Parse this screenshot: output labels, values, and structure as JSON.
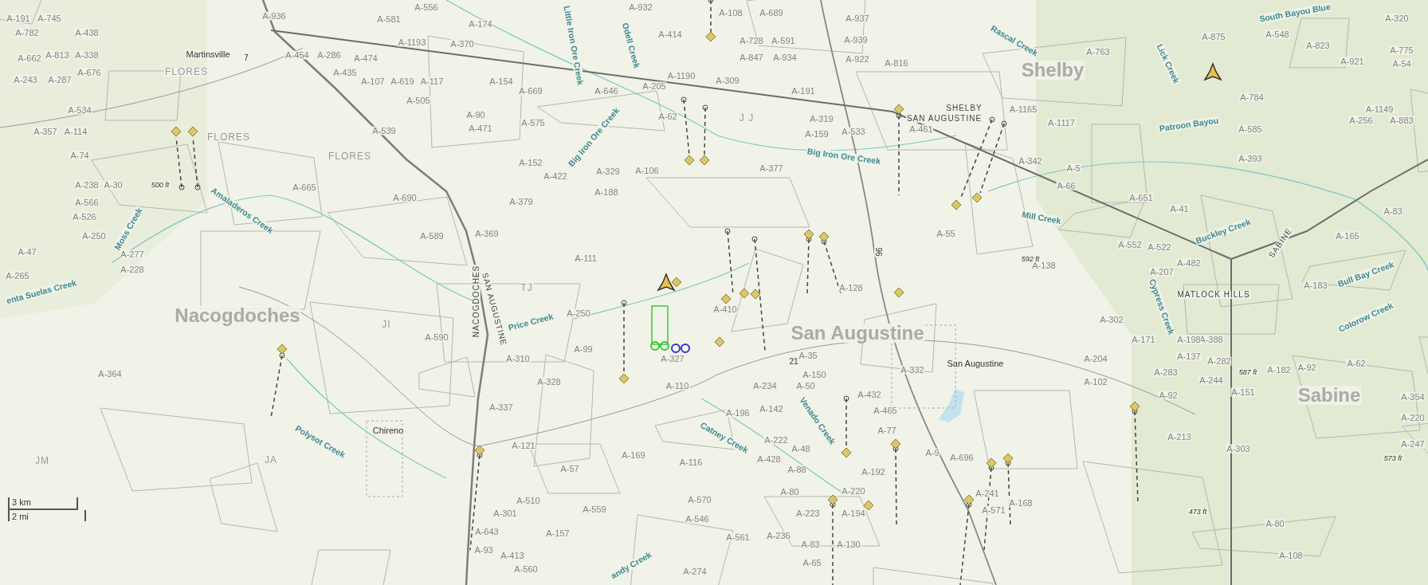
{
  "map": {
    "labels": [
      {
        "text": "Shelby",
        "kind": "county"
      },
      {
        "text": "Nacogdoches",
        "kind": "county"
      },
      {
        "text": "San Augustine",
        "kind": "county"
      },
      {
        "text": "Sabine",
        "kind": "county"
      },
      {
        "text": "Martinsville",
        "kind": "town"
      },
      {
        "text": "Chireno",
        "kind": "town"
      },
      {
        "text": "San Augustine",
        "kind": "town"
      },
      {
        "text": "SHELBY",
        "kind": "boundary"
      },
      {
        "text": "SAN AUGUSTINE",
        "kind": "boundary"
      },
      {
        "text": "MATLOCK HILLS",
        "kind": "boundary"
      },
      {
        "text": "SABINE",
        "kind": "boundary"
      },
      {
        "text": "NACOGDOCHES",
        "kind": "boundary"
      },
      {
        "text": "SAN AUGUSTINE",
        "kind": "boundary"
      },
      {
        "text": "FLORES",
        "kind": "grant"
      },
      {
        "text": "FLORES",
        "kind": "grant"
      },
      {
        "text": "FLORES",
        "kind": "grant"
      },
      {
        "text": "JM",
        "kind": "grant"
      },
      {
        "text": "JA",
        "kind": "grant"
      },
      {
        "text": "JI",
        "kind": "grant"
      },
      {
        "text": "J J",
        "kind": "grant"
      },
      {
        "text": "TJ",
        "kind": "grant"
      },
      {
        "text": "Moss Creek",
        "kind": "creek"
      },
      {
        "text": "Amaladeros Creek",
        "kind": "creek"
      },
      {
        "text": "Little Iron Ore Creek",
        "kind": "creek"
      },
      {
        "text": "Odell Creek",
        "kind": "creek"
      },
      {
        "text": "Big Iron Ore Creek",
        "kind": "creek"
      },
      {
        "text": "Big Iron Ore Creek",
        "kind": "creek"
      },
      {
        "text": "Rascal Creek",
        "kind": "creek"
      },
      {
        "text": "Lick Creek",
        "kind": "creek"
      },
      {
        "text": "South Bayou Blue",
        "kind": "creek"
      },
      {
        "text": "Patroon Bayou",
        "kind": "creek"
      },
      {
        "text": "Mill Creek",
        "kind": "creek"
      },
      {
        "text": "Buckley Creek",
        "kind": "creek"
      },
      {
        "text": "Bull Bay Creek",
        "kind": "creek"
      },
      {
        "text": "Colorow Creek",
        "kind": "creek"
      },
      {
        "text": "Cypress Creek",
        "kind": "creek"
      },
      {
        "text": "Price Creek",
        "kind": "creek"
      },
      {
        "text": "Polysot Creek",
        "kind": "creek"
      },
      {
        "text": "Venado Creek",
        "kind": "creek"
      },
      {
        "text": "Catney Creek",
        "kind": "creek"
      },
      {
        "text": "enta Suelas Creek",
        "kind": "creek"
      },
      {
        "text": "andy Creek",
        "kind": "creek"
      },
      {
        "text": "500 ft",
        "kind": "elevation"
      },
      {
        "text": "592 ft",
        "kind": "elevation"
      },
      {
        "text": "587 ft",
        "kind": "elevation"
      },
      {
        "text": "573 ft",
        "kind": "elevation"
      },
      {
        "text": "473 ft",
        "kind": "elevation"
      },
      {
        "text": "7",
        "kind": "highway"
      },
      {
        "text": "96",
        "kind": "highway"
      },
      {
        "text": "21",
        "kind": "highway"
      }
    ],
    "surveys": [
      "A-191",
      "A-745",
      "A-782",
      "A-438",
      "A-662",
      "A-813",
      "A-338",
      "A-676",
      "A-243",
      "A-287",
      "A-534",
      "A-357",
      "A-114",
      "A-74",
      "A-238",
      "A-30",
      "A-566",
      "A-526",
      "A-250",
      "A-47",
      "A-277",
      "A-228",
      "A-265",
      "A-936",
      "A-556",
      "A-581",
      "A-174",
      "A-1193",
      "A-370",
      "A-454",
      "A-286",
      "A-474",
      "A-435",
      "A-107",
      "A-619",
      "A-117",
      "A-154",
      "A-669",
      "A-505",
      "A-90",
      "A-471",
      "A-575",
      "A-539",
      "A-152",
      "A-422",
      "A-329",
      "A-106",
      "A-188",
      "A-379",
      "A-665",
      "A-690",
      "A-589",
      "A-369",
      "A-111",
      "A-205",
      "A-646",
      "A-932",
      "A-414",
      "A-1190",
      "A-62",
      "A-108",
      "A-689",
      "A-937",
      "A-728",
      "A-591",
      "A-847",
      "A-934",
      "A-939",
      "A-922",
      "A-816",
      "A-309",
      "A-191",
      "A-319",
      "A-159",
      "A-533",
      "A-461",
      "A-1117",
      "A-1165",
      "A-342",
      "A-5",
      "A-66",
      "A-377",
      "A-55",
      "A-763",
      "A-875",
      "A-784",
      "A-585",
      "A-393",
      "A-320",
      "A-775",
      "A-54",
      "A-823",
      "A-921",
      "A-1149",
      "A-256",
      "A-883",
      "A-165",
      "A-83",
      "A-651",
      "A-41",
      "A-482",
      "A-552",
      "A-522",
      "A-207",
      "A-138",
      "A-128",
      "A-183",
      "A-548",
      "A-364",
      "A-590",
      "A-310",
      "A-328",
      "A-337",
      "A-99",
      "A-121",
      "A-169",
      "A-116",
      "A-57",
      "A-510",
      "A-301",
      "A-157",
      "A-559",
      "A-570",
      "A-546",
      "A-643",
      "A-93",
      "A-413",
      "A-274",
      "A-560",
      "A-327",
      "A-110",
      "A-250",
      "A-410",
      "A-35",
      "A-150",
      "A-234",
      "A-50",
      "A-196",
      "A-142",
      "A-222",
      "A-48",
      "A-428",
      "A-88",
      "A-80",
      "A-220",
      "A-223",
      "A-194",
      "A-83",
      "A-130",
      "A-65",
      "A-561",
      "A-236",
      "A-192",
      "A-77",
      "A-465",
      "A-432",
      "A-332",
      "A-9",
      "A-696",
      "A-241",
      "A-571",
      "A-168",
      "A-302",
      "A-204",
      "A-102",
      "A-388",
      "A-137",
      "A-282",
      "A-244",
      "A-151",
      "A-182",
      "A-92",
      "A-62",
      "A-171",
      "A-198",
      "A-283",
      "A-92",
      "A-303",
      "A-354",
      "A-220",
      "A-247",
      "A-80",
      "A-108",
      "A-213"
    ]
  },
  "scale_bar": {
    "metric": "3 km",
    "imperial": "2 mi"
  }
}
